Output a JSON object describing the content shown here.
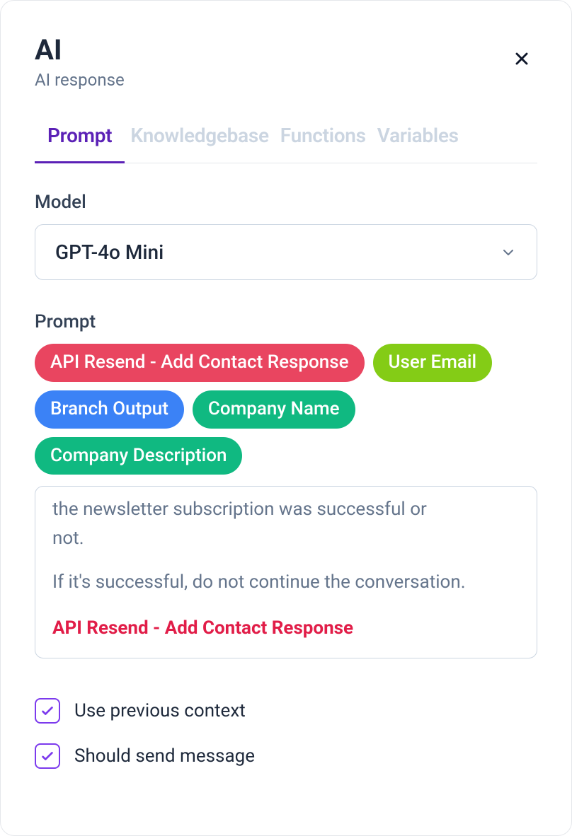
{
  "header": {
    "title": "AI",
    "subtitle": "AI response"
  },
  "tabs": [
    {
      "label": "Prompt",
      "active": true
    },
    {
      "label": "Knowledgebase",
      "active": false
    },
    {
      "label": "Functions",
      "active": false
    },
    {
      "label": "Variables",
      "active": false
    }
  ],
  "model": {
    "label": "Model",
    "value": "GPT-4o Mini"
  },
  "prompt": {
    "label": "Prompt",
    "chips": [
      {
        "label": "API Resend - Add Contact Response",
        "color": "red"
      },
      {
        "label": "User Email",
        "color": "lime"
      },
      {
        "label": "Branch Output",
        "color": "blue"
      },
      {
        "label": "Company Name",
        "color": "green"
      },
      {
        "label": "Company Description",
        "color": "green"
      }
    ],
    "text_truncated_top": "the newsletter subscription was successful or",
    "text_line2": "not.",
    "text_para": "If it's successful, do not continue the conversation.",
    "text_ref": "API Resend - Add Contact Response"
  },
  "checkboxes": {
    "use_previous_context": {
      "label": "Use previous context",
      "checked": true
    },
    "should_send_message": {
      "label": "Should send message",
      "checked": true
    }
  }
}
